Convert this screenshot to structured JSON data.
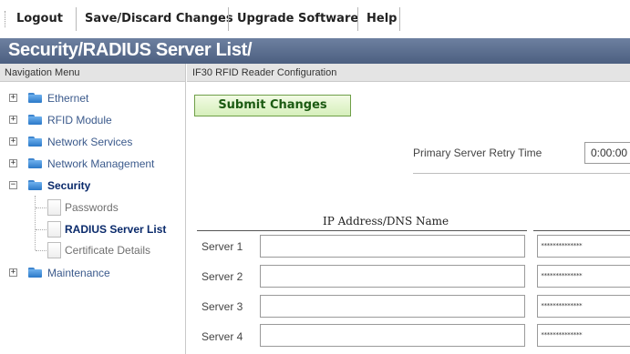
{
  "toolbar": {
    "logout": "Logout",
    "save_discard": "Save/Discard Changes",
    "upgrade": "Upgrade Software",
    "help": "Help"
  },
  "title": "Security/RADIUS Server List/",
  "nav": {
    "header": "Navigation Menu",
    "items": [
      {
        "label": "Ethernet"
      },
      {
        "label": "RFID Module"
      },
      {
        "label": "Network Services"
      },
      {
        "label": "Network Management"
      },
      {
        "label": "Security"
      },
      {
        "label": "Maintenance"
      }
    ],
    "security_children": [
      {
        "label": "Passwords"
      },
      {
        "label": "RADIUS Server List"
      },
      {
        "label": "Certificate Details"
      }
    ],
    "expand_symbol": "+",
    "collapse_symbol": "−"
  },
  "config": {
    "header": "IF30 RFID Reader Configuration",
    "submit_label": "Submit Changes",
    "retry_label": "Primary Server Retry Time",
    "retry_value": "0:00:00",
    "ip_column": "IP Address/DNS Name",
    "servers": [
      {
        "label": "Server 1",
        "ip": "",
        "secret": "**************"
      },
      {
        "label": "Server 2",
        "ip": "",
        "secret": "**************"
      },
      {
        "label": "Server 3",
        "ip": "",
        "secret": "**************"
      },
      {
        "label": "Server 4",
        "ip": "",
        "secret": "**************"
      }
    ]
  },
  "colors": {
    "title_bar": "#5b6e8f",
    "nav_link": "#3b5a8c",
    "active": "#0a2a6b",
    "submit_text": "#1b5a12",
    "folder": "#3f86cf"
  }
}
